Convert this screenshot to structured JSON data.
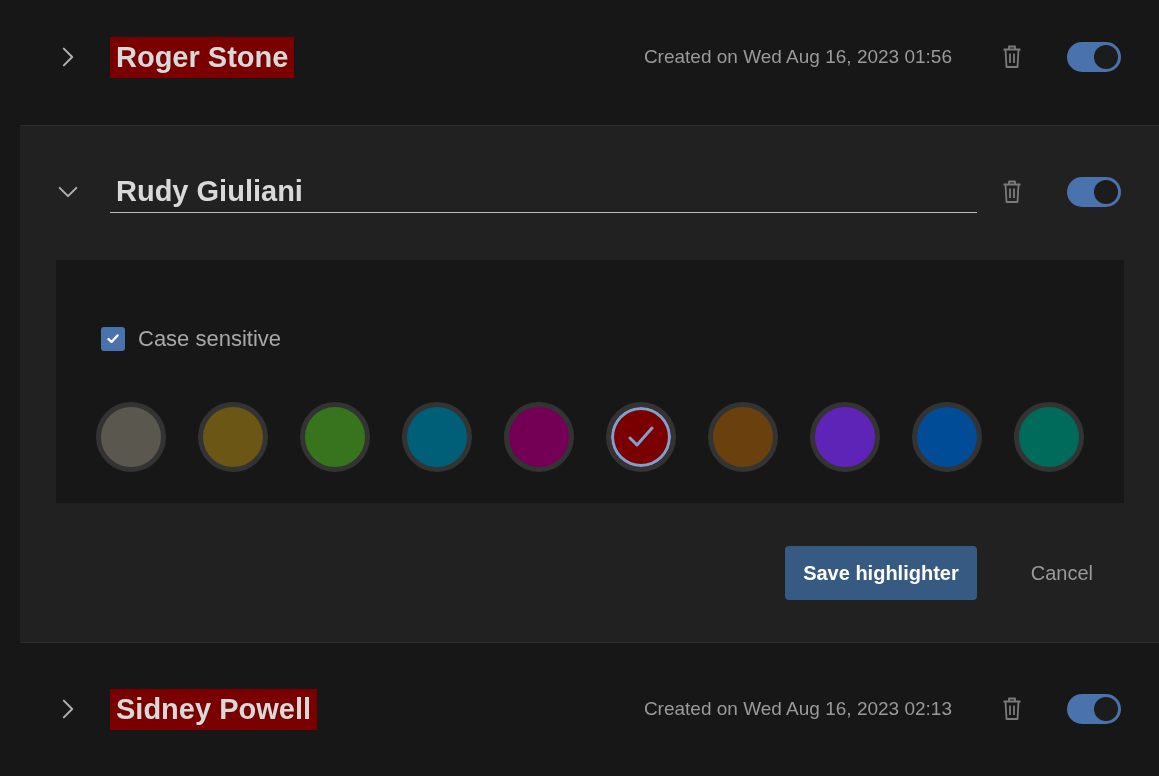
{
  "highlighters": [
    {
      "name": "Roger Stone",
      "color": "#7a0000",
      "expanded": false,
      "created": "Created on Wed Aug 16, 2023 01:56",
      "enabled": true
    },
    {
      "name": "Rudy Giuliani",
      "expanded": true,
      "enabled": true,
      "case_sensitive": {
        "label": "Case sensitive",
        "checked": true
      },
      "swatches": [
        {
          "color": "#5a574f",
          "selected": false
        },
        {
          "color": "#6b5615",
          "selected": false
        },
        {
          "color": "#38741d",
          "selected": false
        },
        {
          "color": "#005f78",
          "selected": false
        },
        {
          "color": "#730055",
          "selected": false
        },
        {
          "color": "#7a0000",
          "selected": true
        },
        {
          "color": "#6a400f",
          "selected": false
        },
        {
          "color": "#5e24b8",
          "selected": false
        },
        {
          "color": "#004c96",
          "selected": false
        },
        {
          "color": "#006b5a",
          "selected": false
        }
      ],
      "buttons": [
        {
          "label": "Save highlighter",
          "kind": "primary"
        },
        {
          "label": "Cancel",
          "kind": "text"
        }
      ]
    },
    {
      "name": "Sidney Powell",
      "color": "#7a0000",
      "expanded": false,
      "created": "Created on Wed Aug 16, 2023 02:13",
      "enabled": true
    }
  ]
}
